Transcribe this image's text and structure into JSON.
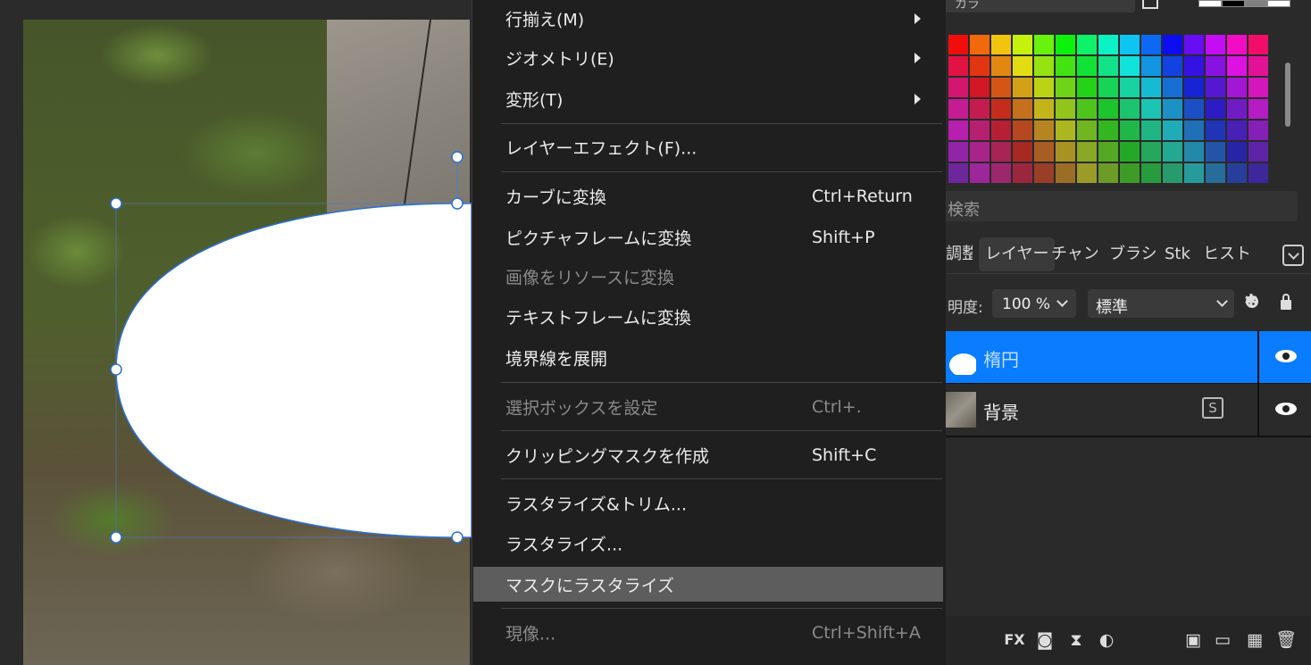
{
  "menu": {
    "items": [
      {
        "label": "行揃え(M)",
        "shortcut": "",
        "submenu": true,
        "disabled": false
      },
      {
        "label": "ジオメトリ(E)",
        "shortcut": "",
        "submenu": true,
        "disabled": false
      },
      {
        "label": "変形(T)",
        "shortcut": "",
        "submenu": true,
        "disabled": false
      },
      {
        "label": "レイヤーエフェクト(F)...",
        "shortcut": "",
        "submenu": false,
        "disabled": false
      },
      {
        "label": "カーブに変換",
        "shortcut": "Ctrl+Return",
        "submenu": false,
        "disabled": false
      },
      {
        "label": "ピクチャフレームに変換",
        "shortcut": "Shift+P",
        "submenu": false,
        "disabled": false
      },
      {
        "label": "画像をリソースに変換",
        "shortcut": "",
        "submenu": false,
        "disabled": true
      },
      {
        "label": "テキストフレームに変換",
        "shortcut": "",
        "submenu": false,
        "disabled": false
      },
      {
        "label": "境界線を展開",
        "shortcut": "",
        "submenu": false,
        "disabled": false
      },
      {
        "label": "選択ボックスを設定",
        "shortcut": "Ctrl+.",
        "submenu": false,
        "disabled": true
      },
      {
        "label": "クリッピングマスクを作成",
        "shortcut": "Shift+C",
        "submenu": false,
        "disabled": false
      },
      {
        "label": "ラスタライズ&トリム...",
        "shortcut": "",
        "submenu": false,
        "disabled": false
      },
      {
        "label": "ラスタライズ...",
        "shortcut": "",
        "submenu": false,
        "disabled": false
      },
      {
        "label": "マスクにラスタライズ",
        "shortcut": "",
        "submenu": false,
        "disabled": false,
        "highlighted": true
      },
      {
        "label": "現像...",
        "shortcut": "Ctrl+Shift+A",
        "submenu": false,
        "disabled": true
      }
    ]
  },
  "panel": {
    "swatch_header": "カラ",
    "search_placeholder": "検索",
    "tabs": [
      "調整",
      "レイヤー",
      "チャンネ",
      "ブラシ",
      "Stk",
      "ヒストリ"
    ],
    "active_tab": "レイヤー",
    "opacity_label": "明度:",
    "opacity_value": "100 %",
    "blend_mode": "標準",
    "layers": [
      {
        "name": "楕円",
        "selected": true
      },
      {
        "name": "背景",
        "selected": false
      }
    ]
  },
  "colors": {
    "accent": "#0a7cff",
    "menu_bg": "#1f1f1f",
    "menu_highlight": "#5d5d5d",
    "panel_bg": "#2a2a2a"
  },
  "bottom_icons": [
    "fx-icon",
    "mask-icon",
    "hourglass-icon",
    "adjustment-icon",
    "pixel-layer-icon",
    "folder-icon",
    "checker-icon",
    "trash-icon"
  ]
}
